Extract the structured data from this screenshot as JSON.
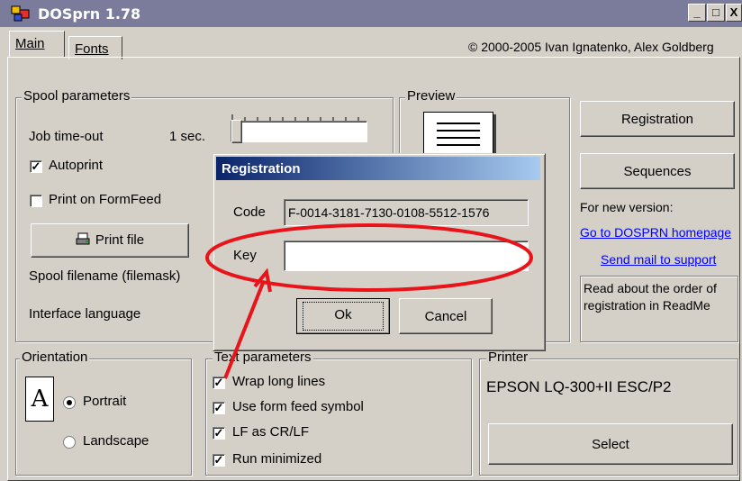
{
  "window": {
    "title": "DOSprn 1.78",
    "minimize": "_",
    "maximize": "□",
    "close": "X"
  },
  "tabs": [
    {
      "label": "Main"
    },
    {
      "label": "Fonts"
    }
  ],
  "copyright": "© 2000-2005 Ivan Ignatenko, Alex Goldberg",
  "spool": {
    "legend": "Spool parameters",
    "job_timeout_label": "Job time-out",
    "job_timeout_value": "1 sec.",
    "autoprint_label": "Autoprint",
    "autoprint_checked": true,
    "print_on_formfeed_label": "Print on FormFeed",
    "print_on_formfeed_checked": false,
    "print_file_button": "Print file",
    "spool_filename_label": "Spool filename (filemask)",
    "interface_language_label": "Interface language"
  },
  "preview": {
    "legend": "Preview"
  },
  "right": {
    "registration_button": "Registration",
    "sequences_button": "Sequences",
    "new_version_label": "For new version:",
    "homepage_link": "Go to DOSPRN homepage",
    "support_link": "Send mail to support",
    "readme_note": "Read about the order of registration in ReadMe"
  },
  "orientation": {
    "legend": "Orientation",
    "portrait_label": "Portrait",
    "landscape_label": "Landscape",
    "selected": "Portrait",
    "icon_letter": "A"
  },
  "text_params": {
    "legend": "Text parameters",
    "items": [
      {
        "label": "Wrap long lines",
        "checked": true
      },
      {
        "label": "Use form feed symbol",
        "checked": true
      },
      {
        "label": "LF as CR/LF",
        "checked": true
      },
      {
        "label": "Run minimized",
        "checked": true
      }
    ]
  },
  "printer": {
    "legend": "Printer",
    "name": "EPSON LQ-300+II ESC/P2",
    "select_button": "Select"
  },
  "dialog": {
    "title": "Registration",
    "code_label": "Code",
    "code_value": "F-0014-3181-7130-0108-5512-1576",
    "key_label": "Key",
    "key_value": "",
    "ok_button": "Ok",
    "cancel_button": "Cancel"
  },
  "annotation_color": "#e8141a"
}
